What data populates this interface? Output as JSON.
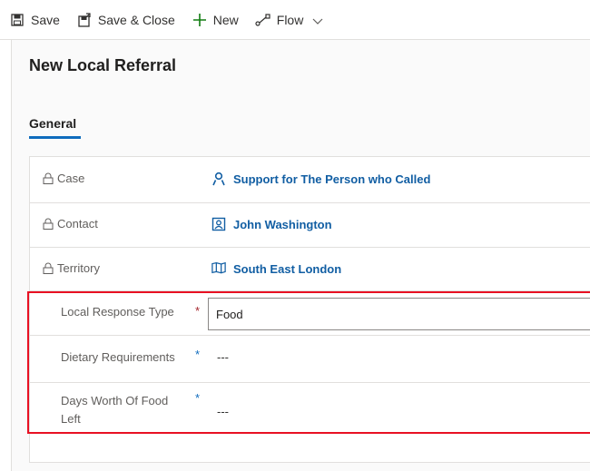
{
  "toolbar": {
    "save_label": "Save",
    "save_close_label": "Save & Close",
    "new_label": "New",
    "flow_label": "Flow"
  },
  "page": {
    "title": "New Local Referral"
  },
  "tabs": [
    {
      "label": "General",
      "selected": true
    }
  ],
  "form": {
    "case": {
      "label": "Case",
      "value": "Support for The Person who Called",
      "icon": "person-icon"
    },
    "contact": {
      "label": "Contact",
      "value": "John Washington",
      "icon": "contact-card-icon"
    },
    "territory": {
      "label": "Territory",
      "value": "South East London",
      "icon": "map-icon"
    },
    "local_response_type": {
      "label": "Local Response Type",
      "required_marker": "*",
      "value": "Food"
    },
    "dietary_requirements": {
      "label": "Dietary Requirements",
      "required_marker": "*",
      "value": "---"
    },
    "days_worth_food_left": {
      "label": "Days Worth Of Food Left",
      "required_marker": "*",
      "value": "---"
    }
  },
  "colors": {
    "accent": "#0f6cbd",
    "highlight_border": "#e81123",
    "required_red": "#a4262c",
    "lookup_link": "#115ea3"
  }
}
